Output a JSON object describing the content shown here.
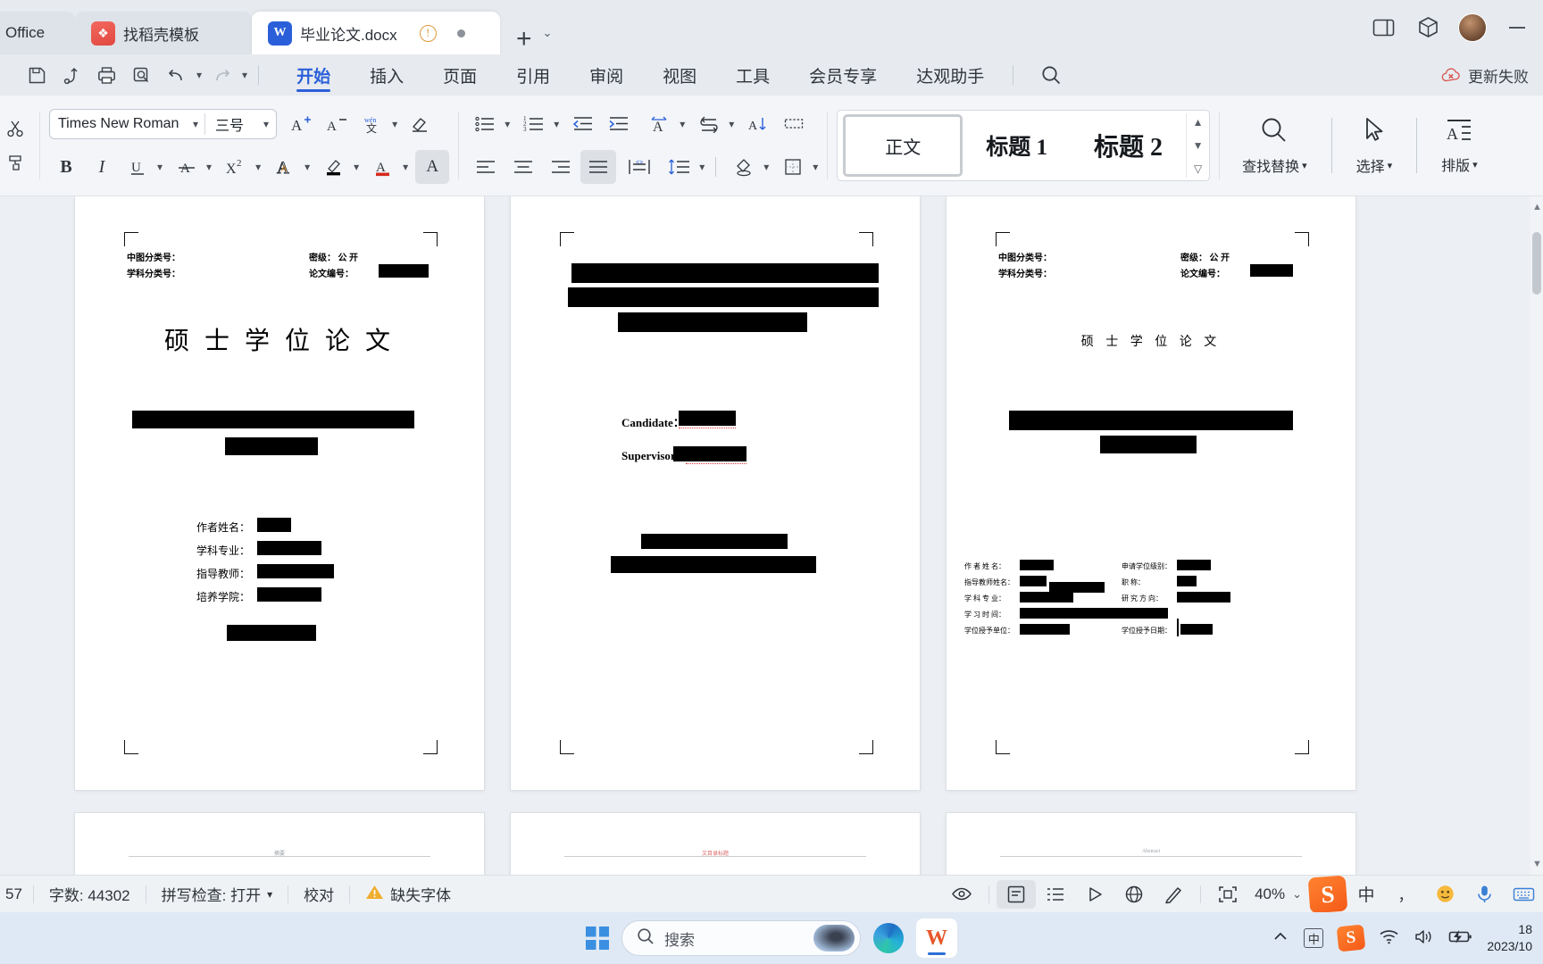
{
  "titlebar": {
    "tabs": [
      {
        "label": "Office",
        "icon": "office-icon",
        "active": false
      },
      {
        "label": "找稻壳模板",
        "icon": "docer-icon",
        "active": false
      },
      {
        "label": "毕业论文.docx",
        "icon": "word-doc-icon",
        "active": true
      }
    ],
    "new_tab_label": "+",
    "tab_list_caret": "⌄",
    "window_controls": [
      "sidebar-panel-icon",
      "cube-icon",
      "avatar",
      "minimize-icon"
    ]
  },
  "menubar": {
    "quick_access": [
      "save-icon",
      "save-as-icon",
      "print-icon",
      "print-preview-icon",
      "undo-icon",
      "redo-icon",
      "customize-caret-icon"
    ],
    "items": [
      {
        "label": "开始",
        "active": true
      },
      {
        "label": "插入",
        "active": false
      },
      {
        "label": "页面",
        "active": false
      },
      {
        "label": "引用",
        "active": false
      },
      {
        "label": "审阅",
        "active": false
      },
      {
        "label": "视图",
        "active": false
      },
      {
        "label": "工具",
        "active": false
      },
      {
        "label": "会员专享",
        "active": false
      },
      {
        "label": "达观助手",
        "active": false
      }
    ],
    "search_icon": "search-icon",
    "update_status": "更新失败"
  },
  "ribbon": {
    "font_name": "Times New Roman",
    "font_size": "三号",
    "font_tools": [
      "grow-font-icon",
      "shrink-font-icon",
      "pinyin-guide-icon",
      "clear-format-icon"
    ],
    "char_tools": [
      "bold-icon",
      "italic-icon",
      "underline-icon",
      "strikethrough-icon",
      "superscript-icon",
      "text-effects-icon",
      "highlight-icon",
      "font-color-icon",
      "character-shading-icon"
    ],
    "para_tools_row1": [
      "bullet-list-icon",
      "numbered-list-icon",
      "decrease-indent-icon",
      "increase-indent-icon",
      "asian-layout-icon",
      "line-direction-icon",
      "sort-icon",
      "show-marks-icon"
    ],
    "para_tools_row2": [
      "align-left-icon",
      "align-center-icon",
      "align-right-icon",
      "justify-icon",
      "distribute-icon",
      "line-spacing-icon",
      "shading-icon",
      "borders-icon"
    ],
    "styles": [
      {
        "label": "正文",
        "selected": true
      },
      {
        "label": "标题 1",
        "selected": false
      },
      {
        "label": "标题 2",
        "selected": false
      }
    ],
    "style_scroll": [
      "scroll-up-caret",
      "scroll-down-caret",
      "more-styles-caret"
    ],
    "big_buttons": [
      {
        "label": "查找替换",
        "icon": "search-icon",
        "caret": "⌄"
      },
      {
        "label": "选择",
        "icon": "cursor-select-icon",
        "caret": "⌄"
      },
      {
        "label": "排版",
        "icon": "typeset-icon",
        "caret": "⌄"
      }
    ]
  },
  "document": {
    "pages": [
      {
        "name": "page-1",
        "header_left": [
          "中图分类号：",
          "学科分类号："
        ],
        "header_right": [
          "密级： 公 开",
          "论文编号："
        ],
        "title": "硕 士 学 位 论 文",
        "fields": [
          "作者姓名：",
          "学科专业：",
          "指导教师：",
          "培养学院："
        ],
        "footer": "摘要"
      },
      {
        "name": "page-2",
        "candidate_label": "Candidate：",
        "supervisor_label": "Supervisor:",
        "footer": "文目录标题"
      },
      {
        "name": "page-3",
        "header_left": [
          "中图分类号：",
          "学科分类号："
        ],
        "header_right": [
          "密级： 公 开",
          "论文编号："
        ],
        "title": "硕 士 学 位 论 文",
        "fields_left": [
          "作 者 姓 名：",
          "指导教师姓名：",
          "学 科 专 业：",
          "学 习 时 间：",
          "学位授予单位："
        ],
        "fields_right": [
          "申请学位级别：",
          "职      称：",
          "研 究 方 向：",
          "",
          "学位授予日期："
        ],
        "footer": "Abstract"
      }
    ]
  },
  "statusbar": {
    "page_indicator": "57",
    "word_count": "字数: 44302",
    "spellcheck": "拼写检查: 打开",
    "proofread": "校对",
    "missing_font": "缺失字体",
    "view_icons": [
      "eye-icon",
      "page-view-icon",
      "outline-view-icon",
      "read-view-icon",
      "web-view-icon",
      "pen-icon",
      "fullscreen-icon"
    ],
    "zoom": "40%",
    "zoom_caret": "⌄",
    "ime_icon": "sogou-icon",
    "ime_lang": "中",
    "ime_tools": [
      "punctuation-icon",
      "emoji-icon",
      "voice-icon",
      "keyboard-icon"
    ]
  },
  "taskbar": {
    "start_label": "start-button",
    "search_placeholder": "搜索",
    "apps": [
      "edge-icon",
      "wps-icon"
    ],
    "tray": [
      "chevron-up-icon",
      "ime-cn-icon",
      "sogou-tray-icon",
      "wifi-icon",
      "volume-icon",
      "battery-charging-icon"
    ],
    "clock_time": "18",
    "clock_date": "2023/10"
  }
}
